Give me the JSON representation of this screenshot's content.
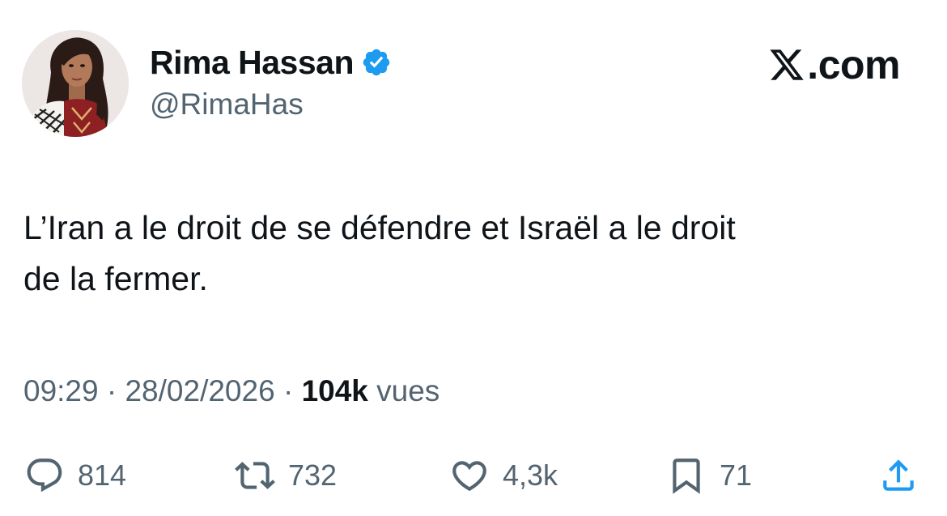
{
  "author": {
    "display_name": "Rima Hassan",
    "handle": "@RimaHas",
    "verified": true,
    "avatar": "profile-photo"
  },
  "brand": {
    "logo_icon": "x-logo-icon",
    "logo_suffix": ".com"
  },
  "tweet": {
    "text": "L’Iran a le droit de se défendre et Israël a le droit\nde la fermer."
  },
  "meta": {
    "time": "09:29",
    "separator": "·",
    "date": "28/02/2026",
    "views_count": "104k",
    "views_label": "vues"
  },
  "actions": {
    "reply": {
      "icon": "reply-icon",
      "count": "814"
    },
    "repost": {
      "icon": "repost-icon",
      "count": "732"
    },
    "like": {
      "icon": "heart-icon",
      "count": "4,3k"
    },
    "bookmark": {
      "icon": "bookmark-icon",
      "count": "71"
    },
    "share": {
      "icon": "share-icon"
    }
  },
  "colors": {
    "text_primary": "#0f1419",
    "text_secondary": "#536471",
    "verified_blue": "#1d9bf0"
  }
}
